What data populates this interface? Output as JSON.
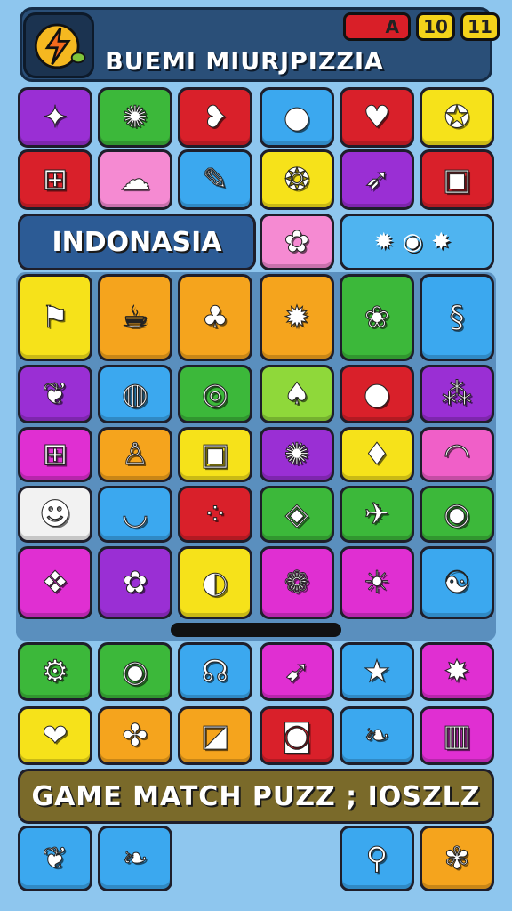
{
  "header": {
    "title": "BUEMI MIURJPIZZIA",
    "counter_red": "A",
    "counter_yellow_1": "10",
    "counter_yellow_2": "11"
  },
  "banners": {
    "indonesia": "INDONASIA",
    "game": "GAME MATCH PUZZ ; IOSZLZ",
    "icons": "✹◉✸"
  },
  "colors": {
    "purple": "#9a2fd4",
    "green": "#3cb83a",
    "red": "#d9202a",
    "blue": "#3ba8ef",
    "yellow": "#f6e21a",
    "pink": "#f05fc8",
    "orange": "#f5a41d",
    "white": "#f2f2f2",
    "magenta": "#e02fd2",
    "lime": "#8fd83a",
    "lightpink": "#f58ad2"
  },
  "tiles": [
    {
      "row": 0,
      "col": 0,
      "color": "purple",
      "icon": "leaf-icon",
      "glyph": "✦"
    },
    {
      "row": 0,
      "col": 1,
      "color": "green",
      "icon": "sun-icon",
      "glyph": "✺"
    },
    {
      "row": 0,
      "col": 2,
      "color": "red",
      "icon": "heart-bubble-icon",
      "glyph": "❥"
    },
    {
      "row": 0,
      "col": 3,
      "color": "blue",
      "icon": "balls-icon",
      "glyph": "●"
    },
    {
      "row": 0,
      "col": 4,
      "color": "red",
      "icon": "heart-icon",
      "glyph": "♥"
    },
    {
      "row": 0,
      "col": 5,
      "color": "yellow",
      "icon": "gamepad-icon",
      "glyph": "✪"
    },
    {
      "row": 1,
      "col": 0,
      "color": "red",
      "icon": "controller-icon",
      "glyph": "⊞"
    },
    {
      "row": 1,
      "col": 1,
      "color": "lightpink",
      "icon": "map-icon",
      "glyph": "☁"
    },
    {
      "row": 1,
      "col": 2,
      "color": "blue",
      "icon": "racket-icon",
      "glyph": "✎"
    },
    {
      "row": 1,
      "col": 3,
      "color": "yellow",
      "icon": "fruit-icon",
      "glyph": "❂"
    },
    {
      "row": 1,
      "col": 4,
      "color": "purple",
      "icon": "arrow-icon",
      "glyph": "➶"
    },
    {
      "row": 1,
      "col": 5,
      "color": "red",
      "icon": "calendar-icon",
      "glyph": "▣"
    },
    {
      "row": 2,
      "col": 3,
      "color": "lightpink",
      "icon": "gear-icon",
      "glyph": "✿"
    },
    {
      "row": 3,
      "col": 0,
      "color": "yellow",
      "icon": "flag-icon",
      "glyph": "⚑"
    },
    {
      "row": 3,
      "col": 1,
      "color": "orange",
      "icon": "cup-icon",
      "glyph": "☕"
    },
    {
      "row": 3,
      "col": 2,
      "color": "orange",
      "icon": "palm-tree-icon",
      "glyph": "♣"
    },
    {
      "row": 3,
      "col": 3,
      "color": "orange",
      "icon": "bulb-icon",
      "glyph": "✹"
    },
    {
      "row": 3,
      "col": 4,
      "color": "green",
      "icon": "sunflower-icon",
      "glyph": "❀"
    },
    {
      "row": 3,
      "col": 5,
      "color": "blue",
      "icon": "swirl-icon",
      "glyph": "§"
    },
    {
      "row": 4,
      "col": 0,
      "color": "purple",
      "icon": "leaf-icon",
      "glyph": "❦"
    },
    {
      "row": 4,
      "col": 1,
      "color": "blue",
      "icon": "globe-icon",
      "glyph": "◍"
    },
    {
      "row": 4,
      "col": 2,
      "color": "green",
      "icon": "target-icon",
      "glyph": "◎"
    },
    {
      "row": 4,
      "col": 3,
      "color": "lime",
      "icon": "balloon-icon",
      "glyph": "♠"
    },
    {
      "row": 4,
      "col": 4,
      "color": "red",
      "icon": "fruits-icon",
      "glyph": "●"
    },
    {
      "row": 4,
      "col": 5,
      "color": "purple",
      "icon": "berries-icon",
      "glyph": "⁂"
    },
    {
      "row": 5,
      "col": 0,
      "color": "magenta",
      "icon": "controller-icon",
      "glyph": "⊞"
    },
    {
      "row": 5,
      "col": 1,
      "color": "orange",
      "icon": "bowling-pin-icon",
      "glyph": "♙"
    },
    {
      "row": 5,
      "col": 2,
      "color": "yellow",
      "icon": "radio-icon",
      "glyph": "▣"
    },
    {
      "row": 5,
      "col": 3,
      "color": "purple",
      "icon": "sun-icon",
      "glyph": "✺"
    },
    {
      "row": 5,
      "col": 4,
      "color": "yellow",
      "icon": "ice-cream-icon",
      "glyph": "♦"
    },
    {
      "row": 5,
      "col": 5,
      "color": "pink",
      "icon": "rainbow-icon",
      "glyph": "◠"
    },
    {
      "row": 6,
      "col": 0,
      "color": "white",
      "icon": "face-icon",
      "glyph": "☻"
    },
    {
      "row": 6,
      "col": 1,
      "color": "blue",
      "icon": "melon-icon",
      "glyph": "◡"
    },
    {
      "row": 6,
      "col": 2,
      "color": "red",
      "icon": "domino-icon",
      "glyph": "⁘"
    },
    {
      "row": 6,
      "col": 3,
      "color": "green",
      "icon": "cube-icon",
      "glyph": "◈"
    },
    {
      "row": 6,
      "col": 4,
      "color": "green",
      "icon": "plane-icon",
      "glyph": "✈"
    },
    {
      "row": 6,
      "col": 5,
      "color": "green",
      "icon": "eye-icon",
      "glyph": "◉"
    },
    {
      "row": 7,
      "col": 0,
      "color": "magenta",
      "icon": "chat-icon",
      "glyph": "❖"
    },
    {
      "row": 7,
      "col": 1,
      "color": "purple",
      "icon": "flowers-icon",
      "glyph": "✿"
    },
    {
      "row": 7,
      "col": 2,
      "color": "yellow",
      "icon": "lollipop-icon",
      "glyph": "◐"
    },
    {
      "row": 7,
      "col": 3,
      "color": "magenta",
      "icon": "cherries-icon",
      "glyph": "❁"
    },
    {
      "row": 7,
      "col": 4,
      "color": "magenta",
      "icon": "sun-face-icon",
      "glyph": "☀"
    },
    {
      "row": 7,
      "col": 5,
      "color": "blue",
      "icon": "ring-icon",
      "glyph": "☯"
    },
    {
      "row": 8,
      "col": 0,
      "color": "green",
      "icon": "hot-air-balloon-icon",
      "glyph": "⚙"
    },
    {
      "row": 8,
      "col": 1,
      "color": "green",
      "icon": "donut-icon",
      "glyph": "◉"
    },
    {
      "row": 8,
      "col": 2,
      "color": "blue",
      "icon": "tooth-icon",
      "glyph": "☊"
    },
    {
      "row": 8,
      "col": 3,
      "color": "magenta",
      "icon": "rocket-icon",
      "glyph": "➹"
    },
    {
      "row": 8,
      "col": 4,
      "color": "blue",
      "icon": "star-icon",
      "glyph": "★"
    },
    {
      "row": 8,
      "col": 5,
      "color": "magenta",
      "icon": "cone-icon",
      "glyph": "✸"
    },
    {
      "row": 9,
      "col": 0,
      "color": "yellow",
      "icon": "strawberry-icon",
      "glyph": "❤"
    },
    {
      "row": 9,
      "col": 1,
      "color": "orange",
      "icon": "puzzle-icon",
      "glyph": "✤"
    },
    {
      "row": 9,
      "col": 2,
      "color": "orange",
      "icon": "window-icon",
      "glyph": "◪"
    },
    {
      "row": 9,
      "col": 3,
      "color": "red",
      "icon": "camera-icon",
      "glyph": "◙"
    },
    {
      "row": 9,
      "col": 4,
      "color": "blue",
      "icon": "leaf-icon",
      "glyph": "❧"
    },
    {
      "row": 9,
      "col": 5,
      "color": "magenta",
      "icon": "bars-icon",
      "glyph": "▥"
    },
    {
      "row": 11,
      "col": 0,
      "color": "blue",
      "icon": "bird-icon",
      "glyph": "❦"
    },
    {
      "row": 11,
      "col": 1,
      "color": "blue",
      "icon": "leaf-icon",
      "glyph": "❧"
    },
    {
      "row": 11,
      "col": 4,
      "color": "blue",
      "icon": "magnifier-icon",
      "glyph": "⚲"
    },
    {
      "row": 11,
      "col": 5,
      "color": "orange",
      "icon": "flower-icon",
      "glyph": "✾"
    }
  ]
}
